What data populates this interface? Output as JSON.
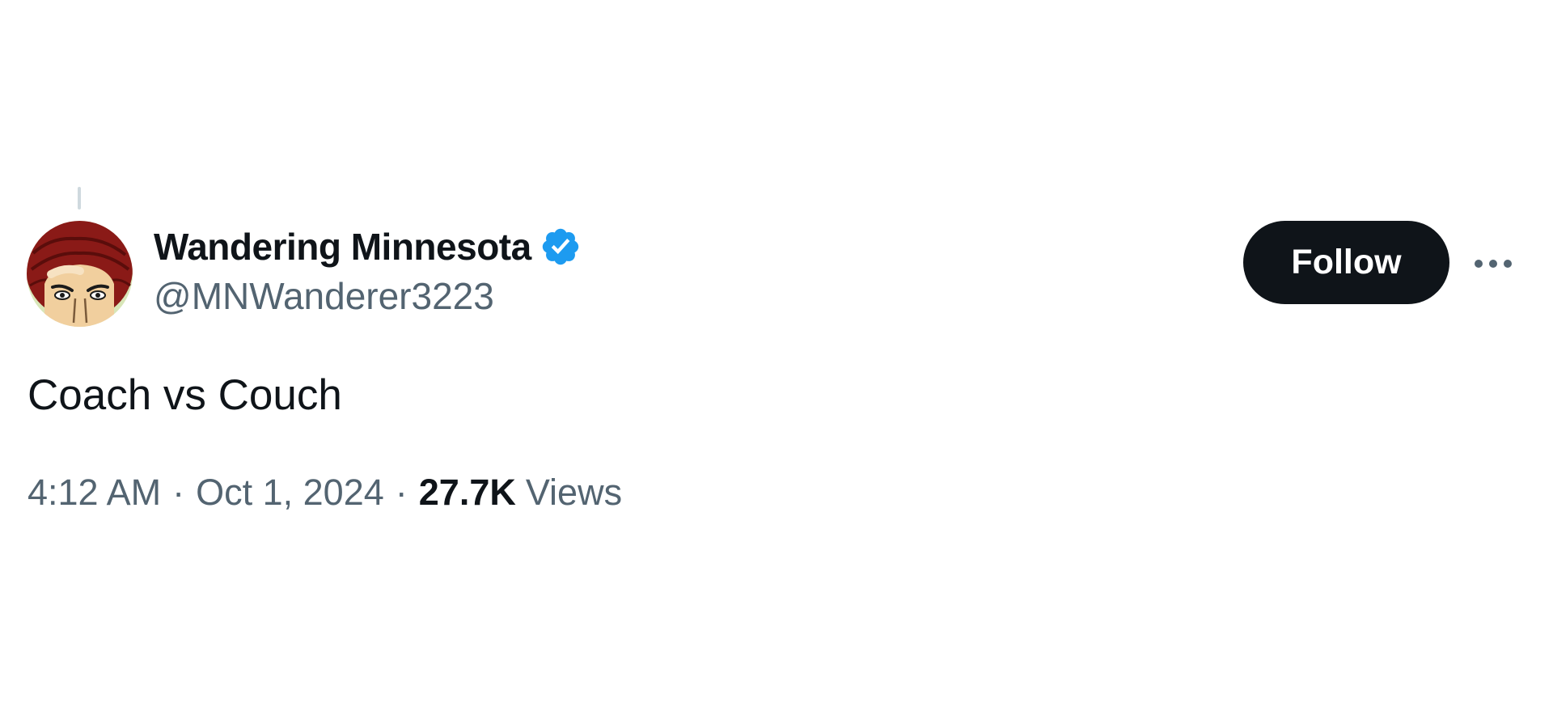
{
  "tweet": {
    "author": {
      "display_name": "Wandering Minnesota",
      "handle": "@MNWanderer3223",
      "verified": true,
      "verified_badge_color": "#1d9bf0",
      "avatar_icon": "cartoon-face-avatar"
    },
    "follow_label": "Follow",
    "more_icon": "more-horizontal-icon",
    "text": "Coach vs Couch",
    "time": "4:12 AM",
    "separator": "·",
    "date": "Oct 1, 2024",
    "views_count": "27.7K",
    "views_label": "Views"
  },
  "colors": {
    "text_primary": "#0f1419",
    "text_secondary": "#536471",
    "follow_button_bg": "#0f1419",
    "follow_button_text": "#ffffff",
    "thread_line": "#cfd9de"
  }
}
